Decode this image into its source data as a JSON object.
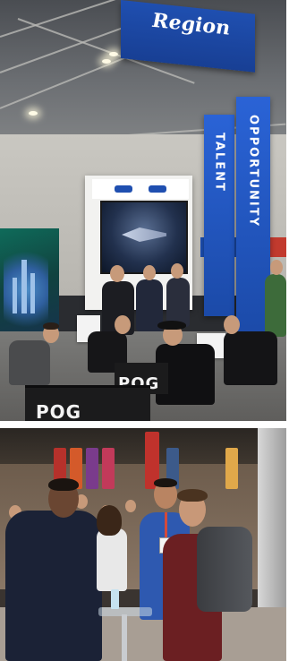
{
  "photos": [
    {
      "id": "top",
      "description_label": "top-expo-photo",
      "signage": {
        "hanging_banner_text": "Region",
        "vertical_banner_left": "TALENT",
        "vertical_banner_right": "OPPORTUNITY",
        "counter_text_front": "POG",
        "counter_text_back": "POG"
      }
    },
    {
      "id": "bottom",
      "description_label": "bottom-expo-photo"
    }
  ],
  "colors": {
    "brand_blue": "#1f4fb0",
    "banner_blue": "#2a63d6",
    "counter_black": "#1b1b1c"
  }
}
